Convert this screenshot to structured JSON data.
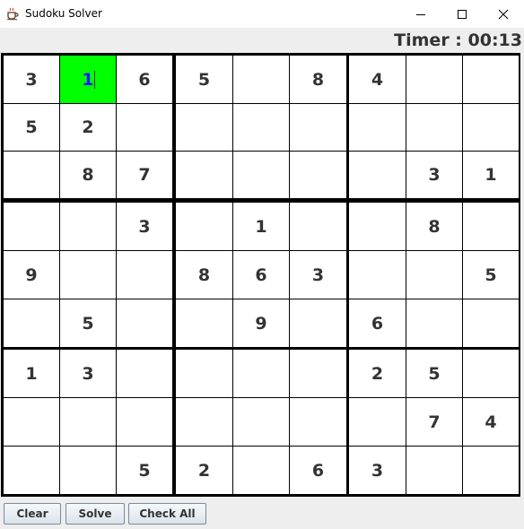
{
  "window": {
    "title": "Sudoku Solver",
    "icon": "java-coffee-cup-icon",
    "controls": [
      "minimize-icon",
      "maximize-icon",
      "close-icon"
    ]
  },
  "timer": {
    "label": "Timer : 00:13"
  },
  "board": {
    "selected_cell": [
      0,
      1
    ],
    "selected_color": "#00ff00",
    "grid": [
      [
        "3",
        "1",
        "6",
        "5",
        "",
        "8",
        "4",
        "",
        ""
      ],
      [
        "5",
        "2",
        "",
        "",
        "",
        "",
        "",
        "",
        ""
      ],
      [
        "",
        "8",
        "7",
        "",
        "",
        "",
        "",
        "3",
        "1"
      ],
      [
        "",
        "",
        "3",
        "",
        "1",
        "",
        "",
        "8",
        ""
      ],
      [
        "9",
        "",
        "",
        "8",
        "6",
        "3",
        "",
        "",
        "5"
      ],
      [
        "",
        "5",
        "",
        "",
        "9",
        "",
        "6",
        "",
        ""
      ],
      [
        "1",
        "3",
        "",
        "",
        "",
        "",
        "2",
        "5",
        ""
      ],
      [
        "",
        "",
        "",
        "",
        "",
        "",
        "",
        "7",
        "4"
      ],
      [
        "",
        "",
        "5",
        "2",
        "",
        "6",
        "3",
        "",
        ""
      ]
    ]
  },
  "buttons": {
    "clear": "Clear",
    "solve": "Solve",
    "check_all": "Check All"
  }
}
